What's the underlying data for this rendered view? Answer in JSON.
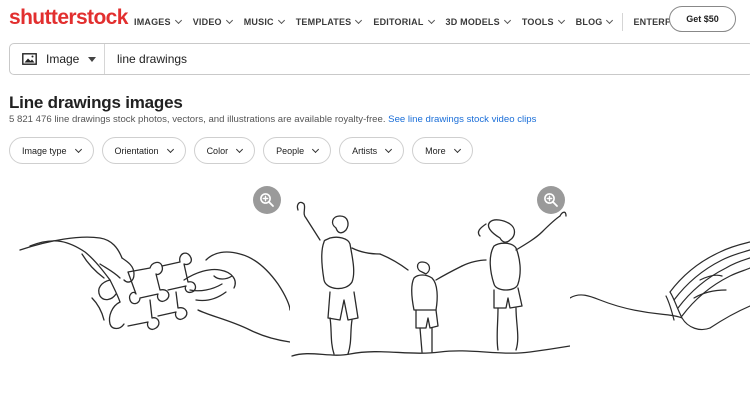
{
  "brand": {
    "logo_text": "shutterstock",
    "accent": "#e22f2f"
  },
  "nav": {
    "items": [
      {
        "label": "IMAGES"
      },
      {
        "label": "VIDEO"
      },
      {
        "label": "MUSIC"
      },
      {
        "label": "TEMPLATES"
      },
      {
        "label": "EDITORIAL"
      },
      {
        "label": "3D MODELS"
      },
      {
        "label": "TOOLS"
      },
      {
        "label": "BLOG"
      }
    ],
    "enterprise": "ENTERPRISE",
    "cta": "Get $50"
  },
  "search": {
    "type_label": "Image",
    "query": "line drawings"
  },
  "header": {
    "title": "Line drawings images",
    "subtitle": "5 821 476 line drawings stock photos, vectors, and illustrations are available royalty-free.",
    "video_link": "See line drawings stock video clips"
  },
  "filters": [
    {
      "label": "Image type"
    },
    {
      "label": "Orientation"
    },
    {
      "label": "Color"
    },
    {
      "label": "People"
    },
    {
      "label": "Artists"
    },
    {
      "label": "More"
    }
  ],
  "icons": {
    "search_type": "image-icon",
    "zoom": "zoom-in-icon",
    "chevron": "chevron-down-icon"
  },
  "link_color": "#1a6ed8"
}
